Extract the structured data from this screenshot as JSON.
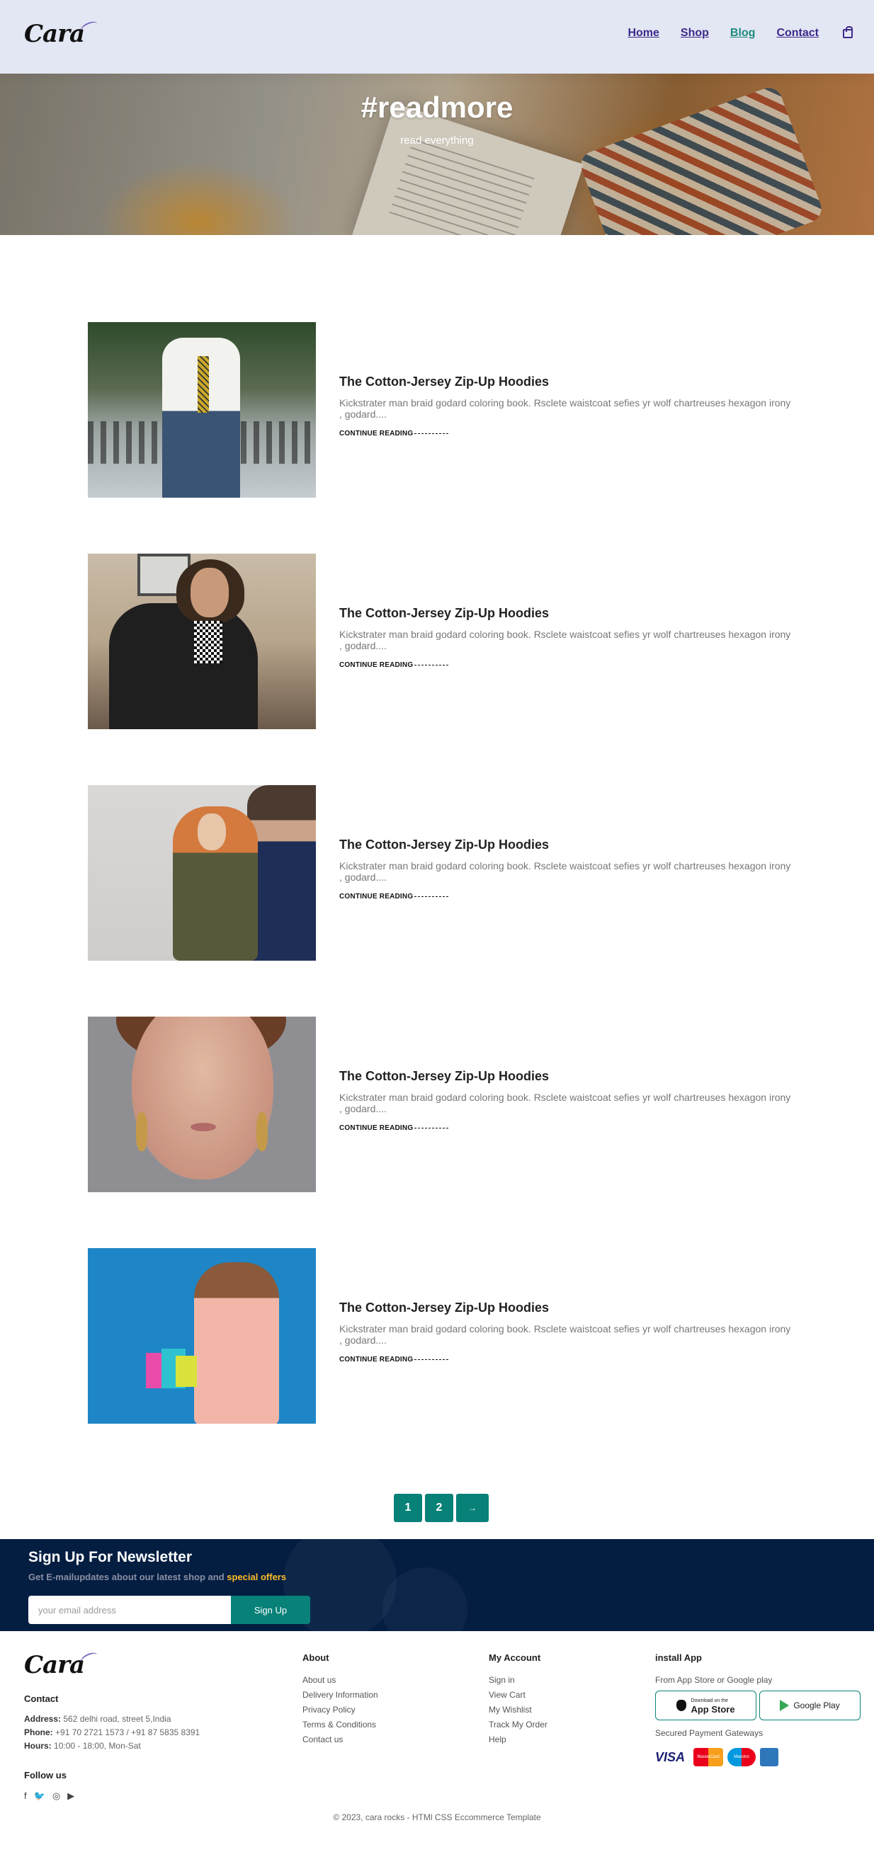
{
  "brand": {
    "logo_text": "Cara"
  },
  "nav": {
    "items": [
      {
        "label": "Home"
      },
      {
        "label": "Shop"
      },
      {
        "label": "Blog"
      },
      {
        "label": "Contact"
      }
    ],
    "active": "Blog",
    "cart_icon": "shopping-bag-icon"
  },
  "hero": {
    "title": "#readmore",
    "subtitle": "read everything"
  },
  "blog": {
    "posts": [
      {
        "title": "The Cotton-Jersey Zip-Up Hoodies",
        "excerpt": "Kickstrater man braid godard coloring book. Rsclete waistcoat sefies yr wolf chartreuses hexagon irony , godard....",
        "link": "CONTINUE READING"
      },
      {
        "title": "The Cotton-Jersey Zip-Up Hoodies",
        "excerpt": "Kickstrater man braid godard coloring book. Rsclete waistcoat sefies yr wolf chartreuses hexagon irony , godard....",
        "link": "CONTINUE READING"
      },
      {
        "title": "The Cotton-Jersey Zip-Up Hoodies",
        "excerpt": "Kickstrater man braid godard coloring book. Rsclete waistcoat sefies yr wolf chartreuses hexagon irony , godard....",
        "link": "CONTINUE READING"
      },
      {
        "title": "The Cotton-Jersey Zip-Up Hoodies",
        "excerpt": "Kickstrater man braid godard coloring book. Rsclete waistcoat sefies yr wolf chartreuses hexagon irony , godard....",
        "link": "CONTINUE READING"
      },
      {
        "title": "The Cotton-Jersey Zip-Up Hoodies",
        "excerpt": "Kickstrater man braid godard coloring book. Rsclete waistcoat sefies yr wolf chartreuses hexagon irony , godard....",
        "link": "CONTINUE READING"
      }
    ]
  },
  "pagination": {
    "pages": [
      "1",
      "2"
    ],
    "next": "→"
  },
  "newsletter": {
    "title": "Sign Up For Newsletter",
    "text": "Get E-mailupdates about our latest shop and",
    "highlight": "special offers",
    "placeholder": "your email address",
    "button": "Sign Up"
  },
  "footer": {
    "logo_text": "Cara",
    "contact": {
      "heading": "Contact",
      "address_label": "Address:",
      "address": "562 delhi road, street 5,India",
      "phone_label": "Phone:",
      "phone": "+91 70 2721 1573 / +91 87 5835 8391",
      "hours_label": "Hours:",
      "hours": "10:00 - 18:00, Mon-Sat"
    },
    "follow": {
      "heading": "Follow us",
      "icons": [
        "facebook-icon",
        "twitter-icon",
        "instagram-icon",
        "youtube-icon"
      ]
    },
    "about": {
      "heading": "About",
      "links": [
        "About us",
        "Delivery Information",
        "Privacy Policy",
        "Terms & Conditions",
        "Contact us"
      ]
    },
    "account": {
      "heading": "My Account",
      "links": [
        "Sign in",
        "View Cart",
        "My Wishlist",
        "Track My Order",
        "Help"
      ]
    },
    "app": {
      "heading": "install App",
      "text": "From App Store or Google play",
      "appstore_small": "Download on the",
      "appstore_big": "App Store",
      "googleplay": "Google Play",
      "payment_text": "Secured Payment Gateways",
      "payments": {
        "visa": "VISA",
        "mastercard": "MasterCard",
        "maestro": "Maestro",
        "amex": "AMEX"
      }
    },
    "copyright": "© 2023, cara rocks - HTMl CSS Eccommerce Template"
  },
  "colors": {
    "accent": "#088178",
    "header_bg": "#e3e6f3",
    "newsletter_bg": "#041e42",
    "highlight": "#ffbd27"
  }
}
